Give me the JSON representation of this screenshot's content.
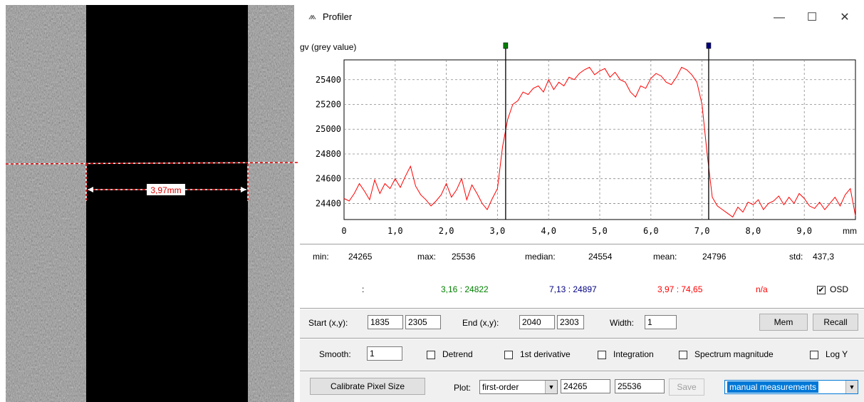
{
  "window": {
    "title": "Profiler"
  },
  "image_view": {
    "measurement_label": "3,97mm"
  },
  "chart_data": {
    "type": "line",
    "ylabel": "gv (grey value)",
    "xunit": "mm",
    "xlim": [
      0,
      10
    ],
    "ylim": [
      24270,
      25560
    ],
    "xticks": [
      "0",
      "1,0",
      "2,0",
      "3,0",
      "4,0",
      "5,0",
      "6,0",
      "7,0",
      "8,0",
      "9,0"
    ],
    "yticks": [
      24400,
      24600,
      24800,
      25000,
      25200,
      25400
    ],
    "grid": true,
    "series": [
      {
        "color": "#ff0000",
        "x": [
          0,
          0.1,
          0.2,
          0.3,
          0.4,
          0.5,
          0.6,
          0.7,
          0.8,
          0.9,
          1.0,
          1.1,
          1.2,
          1.3,
          1.4,
          1.5,
          1.6,
          1.7,
          1.8,
          1.9,
          2.0,
          2.1,
          2.2,
          2.3,
          2.4,
          2.5,
          2.6,
          2.7,
          2.8,
          2.9,
          3.0,
          3.1,
          3.2,
          3.3,
          3.4,
          3.5,
          3.6,
          3.7,
          3.8,
          3.9,
          4.0,
          4.1,
          4.2,
          4.3,
          4.4,
          4.5,
          4.6,
          4.7,
          4.8,
          4.9,
          5.0,
          5.1,
          5.2,
          5.3,
          5.4,
          5.5,
          5.6,
          5.7,
          5.8,
          5.9,
          6.0,
          6.1,
          6.2,
          6.3,
          6.4,
          6.5,
          6.6,
          6.7,
          6.8,
          6.9,
          7.0,
          7.1,
          7.2,
          7.3,
          7.4,
          7.5,
          7.6,
          7.7,
          7.8,
          7.9,
          8.0,
          8.1,
          8.2,
          8.3,
          8.4,
          8.5,
          8.6,
          8.7,
          8.8,
          8.9,
          9.0,
          9.1,
          9.2,
          9.3,
          9.4,
          9.5,
          9.6,
          9.7,
          9.8,
          9.9,
          10.0
        ],
        "y": [
          24440,
          24420,
          24480,
          24560,
          24500,
          24430,
          24590,
          24480,
          24560,
          24520,
          24600,
          24530,
          24620,
          24700,
          24540,
          24470,
          24430,
          24380,
          24420,
          24470,
          24560,
          24450,
          24510,
          24600,
          24430,
          24550,
          24480,
          24400,
          24350,
          24440,
          24520,
          24860,
          25080,
          25200,
          25230,
          25300,
          25280,
          25330,
          25350,
          25300,
          25400,
          25320,
          25380,
          25350,
          25420,
          25400,
          25450,
          25480,
          25500,
          25440,
          25470,
          25490,
          25420,
          25460,
          25400,
          25380,
          25300,
          25260,
          25350,
          25330,
          25410,
          25450,
          25430,
          25380,
          25360,
          25420,
          25500,
          25480,
          25440,
          25380,
          25200,
          24800,
          24450,
          24380,
          24350,
          24320,
          24290,
          24370,
          24330,
          24410,
          24390,
          24430,
          24350,
          24400,
          24420,
          24460,
          24390,
          24450,
          24400,
          24480,
          24440,
          24380,
          24360,
          24410,
          24350,
          24400,
          24450,
          24380,
          24470,
          24520,
          24300
        ]
      }
    ],
    "cursors": [
      {
        "x": 3.16,
        "color": "#008000"
      },
      {
        "x": 7.13,
        "color": "#000080"
      }
    ]
  },
  "stats": {
    "min_label": "min:",
    "min": "24265",
    "max_label": "max:",
    "max": "25536",
    "median_label": "median:",
    "median": "24554",
    "mean_label": "mean:",
    "mean": "24796",
    "std_label": "std:",
    "std": "437,3"
  },
  "readout": {
    "colon": ":",
    "cursor1": "3,16  :  24822",
    "cursor2": "7,13  :  24897",
    "diff": "3,97  :  74,65",
    "na": "n/a",
    "osd_label": "OSD",
    "osd_checked": "✔"
  },
  "controls": {
    "start_label": "Start (x,y):",
    "start_x": "1835",
    "start_y": "2305",
    "end_label": "End (x,y):",
    "end_x": "2040",
    "end_y": "2303",
    "width_label": "Width:",
    "width": "1",
    "mem": "Mem",
    "recall": "Recall",
    "smooth_label": "Smooth:",
    "smooth": "1",
    "detrend": "Detrend",
    "first_derivative": "1st derivative",
    "integration": "Integration",
    "spectrum": "Spectrum magnitude",
    "logy": "Log Y",
    "calibrate": "Calibrate Pixel Size",
    "plot_label": "Plot:",
    "plot_value": "first-order",
    "plot_min": "24265",
    "plot_max": "25536",
    "save": "Save",
    "mode_value": "manual measurements"
  },
  "colors": {
    "cursor_green": "#008000",
    "cursor_blue": "#000080",
    "diff_red": "#ff0000",
    "selection": "#0078d7"
  }
}
